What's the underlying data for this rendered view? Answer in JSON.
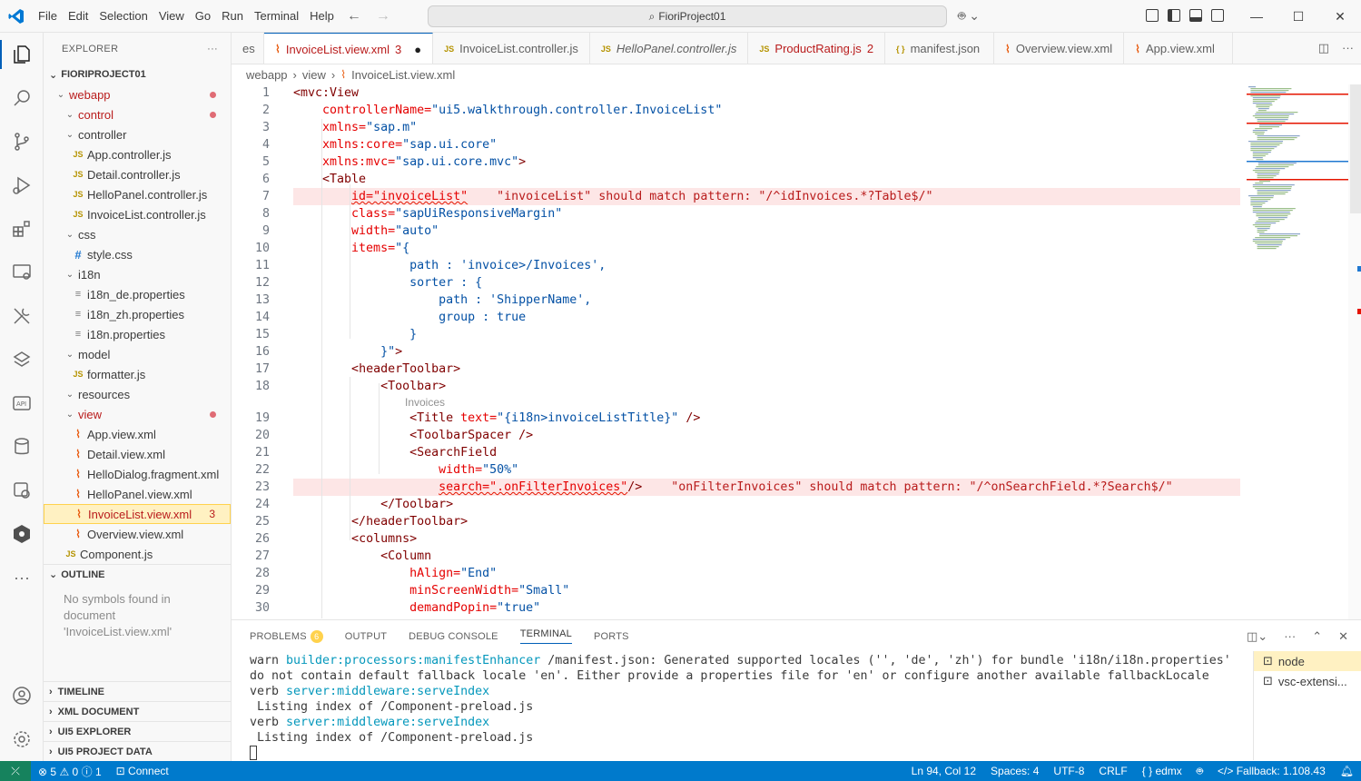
{
  "titlebar": {
    "menu": [
      "File",
      "Edit",
      "Selection",
      "View",
      "Go",
      "Run",
      "Terminal",
      "Help"
    ],
    "search": "FioriProject01"
  },
  "explorer": {
    "header": "EXPLORER",
    "project": "FIORIPROJECT01",
    "tree": [
      {
        "label": "webapp",
        "kind": "folder",
        "depth": 1,
        "error": true,
        "dot": true
      },
      {
        "label": "control",
        "kind": "folder",
        "depth": 2,
        "error": true,
        "dot": true
      },
      {
        "label": "controller",
        "kind": "folder",
        "depth": 2
      },
      {
        "label": "App.controller.js",
        "kind": "js",
        "depth": 3
      },
      {
        "label": "Detail.controller.js",
        "kind": "js",
        "depth": 3
      },
      {
        "label": "HelloPanel.controller.js",
        "kind": "js",
        "depth": 3
      },
      {
        "label": "InvoiceList.controller.js",
        "kind": "js",
        "depth": 3
      },
      {
        "label": "css",
        "kind": "folder",
        "depth": 2
      },
      {
        "label": "style.css",
        "kind": "css",
        "depth": 3
      },
      {
        "label": "i18n",
        "kind": "folder",
        "depth": 2
      },
      {
        "label": "i18n_de.properties",
        "kind": "props",
        "depth": 3
      },
      {
        "label": "i18n_zh.properties",
        "kind": "props",
        "depth": 3
      },
      {
        "label": "i18n.properties",
        "kind": "props",
        "depth": 3
      },
      {
        "label": "model",
        "kind": "folder",
        "depth": 2
      },
      {
        "label": "formatter.js",
        "kind": "js",
        "depth": 3
      },
      {
        "label": "resources",
        "kind": "folder",
        "depth": 2
      },
      {
        "label": "view",
        "kind": "folder",
        "depth": 2,
        "error": true,
        "dot": true
      },
      {
        "label": "App.view.xml",
        "kind": "xml",
        "depth": 3
      },
      {
        "label": "Detail.view.xml",
        "kind": "xml",
        "depth": 3
      },
      {
        "label": "HelloDialog.fragment.xml",
        "kind": "xml",
        "depth": 3
      },
      {
        "label": "HelloPanel.view.xml",
        "kind": "xml",
        "depth": 3
      },
      {
        "label": "InvoiceList.view.xml",
        "kind": "xml",
        "depth": 3,
        "error": true,
        "selected": true,
        "badge": "3"
      },
      {
        "label": "Overview.view.xml",
        "kind": "xml",
        "depth": 3
      },
      {
        "label": "Component.js",
        "kind": "js",
        "depth": 2
      }
    ],
    "outline_title": "OUTLINE",
    "outline_message": "No symbols found in document 'InvoiceList.view.xml'",
    "collapsed_sections": [
      "TIMELINE",
      "XML DOCUMENT",
      "UI5 EXPLORER",
      "UI5 PROJECT DATA"
    ]
  },
  "tabs": [
    {
      "label": "es",
      "icon": "",
      "partial": true
    },
    {
      "label": "InvoiceList.view.xml",
      "icon": "xml",
      "active": true,
      "badge": "3",
      "dirty": true
    },
    {
      "label": "InvoiceList.controller.js",
      "icon": "js"
    },
    {
      "label": "HelloPanel.controller.js",
      "icon": "js",
      "italic": true
    },
    {
      "label": "ProductRating.js",
      "icon": "js",
      "error": true,
      "badge": "2"
    },
    {
      "label": "manifest.json",
      "icon": "json"
    },
    {
      "label": "Overview.view.xml",
      "icon": "xml"
    },
    {
      "label": "App.view.xml",
      "icon": "xml"
    }
  ],
  "breadcrumb": [
    "webapp",
    "view",
    "InvoiceList.view.xml"
  ],
  "editor": {
    "codelens_text": "Invoices",
    "error_annotations": [
      "\"invoiceList\" should match pattern: \"/^idInvoices.*?Table$/\"",
      "\"onFilterInvoices\" should match pattern: \"/^onSearchField.*?Search$/\""
    ],
    "lines": [
      {
        "n": "1",
        "segs": [
          [
            "tag",
            "<mvc:View"
          ]
        ]
      },
      {
        "n": "2",
        "segs": [
          [
            "txt",
            "    controllerName="
          ],
          [
            "str",
            "\"ui5.walkthrough.controller.InvoiceList\""
          ]
        ]
      },
      {
        "n": "3",
        "segs": [
          [
            "txt",
            "    xmlns="
          ],
          [
            "str",
            "\"sap.m\""
          ]
        ]
      },
      {
        "n": "4",
        "segs": [
          [
            "txt",
            "    xmlns:core="
          ],
          [
            "str",
            "\"sap.ui.core\""
          ]
        ]
      },
      {
        "n": "5",
        "segs": [
          [
            "txt",
            "    xmlns:mvc="
          ],
          [
            "str",
            "\"sap.ui.core.mvc\""
          ],
          [
            "tag",
            ">"
          ]
        ]
      },
      {
        "n": "6",
        "segs": [
          [
            "tag",
            "    <Table"
          ]
        ]
      },
      {
        "n": "7",
        "segs": [
          [
            "txt",
            "        "
          ],
          [
            "sq",
            "id=\"invoiceList\""
          ],
          [
            "ann",
            "    \"invoiceList\" should match pattern: \"/^idInvoices.*?Table$/\""
          ]
        ],
        "err": true
      },
      {
        "n": "8",
        "segs": [
          [
            "txt",
            "        class="
          ],
          [
            "str",
            "\"sapUiResponsiveMargin\""
          ]
        ]
      },
      {
        "n": "9",
        "segs": [
          [
            "txt",
            "        width="
          ],
          [
            "str",
            "\"auto\""
          ]
        ]
      },
      {
        "n": "10",
        "segs": [
          [
            "txt",
            "        items="
          ],
          [
            "str",
            "\"{"
          ]
        ]
      },
      {
        "n": "11",
        "segs": [
          [
            "str",
            "                path : 'invoice>/Invoices',"
          ]
        ]
      },
      {
        "n": "12",
        "segs": [
          [
            "str",
            "                sorter : {"
          ]
        ]
      },
      {
        "n": "13",
        "segs": [
          [
            "str",
            "                    path : 'ShipperName',"
          ]
        ]
      },
      {
        "n": "14",
        "segs": [
          [
            "str",
            "                    group : true"
          ]
        ]
      },
      {
        "n": "15",
        "segs": [
          [
            "str",
            "                }"
          ]
        ]
      },
      {
        "n": "16",
        "segs": [
          [
            "str",
            "            }\""
          ],
          [
            "tag",
            ">"
          ]
        ]
      },
      {
        "n": "17",
        "segs": [
          [
            "tag",
            "        <"
          ],
          [
            "tagb",
            "headerToolbar"
          ],
          [
            "tag",
            ">"
          ]
        ]
      },
      {
        "n": "18",
        "segs": [
          [
            "tag",
            "            <"
          ],
          [
            "tagb",
            "Toolbar"
          ],
          [
            "tag",
            ">"
          ]
        ]
      },
      {
        "n": "19",
        "segs": [
          [
            "tag",
            "                <"
          ],
          [
            "tagb",
            "Title"
          ],
          [
            "txt",
            " text="
          ],
          [
            "str",
            "\"{i18n>invoiceListTitle}\""
          ],
          [
            "tag",
            " />"
          ]
        ]
      },
      {
        "n": "20",
        "segs": [
          [
            "tag",
            "                <"
          ],
          [
            "tagb",
            "ToolbarSpacer"
          ],
          [
            "tag",
            " />"
          ]
        ]
      },
      {
        "n": "21",
        "segs": [
          [
            "tag",
            "                <"
          ],
          [
            "tagb",
            "SearchField"
          ]
        ]
      },
      {
        "n": "22",
        "segs": [
          [
            "txt",
            "                    width="
          ],
          [
            "str",
            "\"50%\""
          ]
        ]
      },
      {
        "n": "23",
        "segs": [
          [
            "txt",
            "                    "
          ],
          [
            "sq",
            "search=\".onFilterInvoices\""
          ],
          [
            "tag",
            "/>"
          ],
          [
            "ann",
            "    \"onFilterInvoices\" should match pattern: \"/^onSearchField.*?Search$/\""
          ]
        ],
        "err": true
      },
      {
        "n": "24",
        "segs": [
          [
            "tag",
            "            </"
          ],
          [
            "tagb",
            "Toolbar"
          ],
          [
            "tag",
            ">"
          ]
        ]
      },
      {
        "n": "25",
        "segs": [
          [
            "tag",
            "        </"
          ],
          [
            "tagb",
            "headerToolbar"
          ],
          [
            "tag",
            ">"
          ]
        ]
      },
      {
        "n": "26",
        "segs": [
          [
            "tag",
            "        <"
          ],
          [
            "tagb",
            "columns"
          ],
          [
            "tag",
            ">"
          ]
        ]
      },
      {
        "n": "27",
        "segs": [
          [
            "tag",
            "            <"
          ],
          [
            "tagb",
            "Column"
          ]
        ]
      },
      {
        "n": "28",
        "segs": [
          [
            "txt",
            "                hAlign="
          ],
          [
            "str",
            "\"End\""
          ]
        ]
      },
      {
        "n": "29",
        "segs": [
          [
            "txt",
            "                minScreenWidth="
          ],
          [
            "str",
            "\"Small\""
          ]
        ]
      },
      {
        "n": "30",
        "segs": [
          [
            "txt",
            "                demandPopin="
          ],
          [
            "str",
            "\"true\""
          ]
        ]
      }
    ]
  },
  "panel": {
    "tabs": [
      "PROBLEMS",
      "OUTPUT",
      "DEBUG CONSOLE",
      "TERMINAL",
      "PORTS"
    ],
    "problems_count": "6",
    "active_tab": "TERMINAL",
    "terminal_lines": [
      {
        "kind": "warn",
        "prefix": "warn ",
        "cyan": "builder:processors:manifestEnhancer",
        "text": " /manifest.json: Generated supported locales ('', 'de', 'zh') for bundle 'i18n/i18n.properties' do not contain default fallback locale 'en'. Either provide a properties file for 'en' or configure another available fallbackLocale"
      },
      {
        "kind": "verb",
        "prefix": "verb ",
        "cyan": "server:middleware:serveIndex",
        "text": ""
      },
      {
        "kind": "plain",
        "prefix": "",
        "cyan": "",
        "text": " Listing index of /Component-preload.js"
      },
      {
        "kind": "verb",
        "prefix": "verb ",
        "cyan": "server:middleware:serveIndex",
        "text": ""
      },
      {
        "kind": "plain",
        "prefix": "",
        "cyan": "",
        "text": " Listing index of /Component-preload.js"
      }
    ],
    "terminals": [
      "node",
      "vsc-extensi..."
    ]
  },
  "statusbar": {
    "errors": "5",
    "warnings": "0",
    "info": "1",
    "connect": "Connect",
    "position": "Ln 94, Col 12",
    "spaces": "Spaces: 4",
    "encoding": "UTF-8",
    "eol": "CRLF",
    "language": "edmx",
    "fallback": "Fallback: 1.108.43"
  },
  "colors": {
    "accent": "#005fb8",
    "statusbar": "#007acc",
    "error": "#b91c1c",
    "selected_bg": "#fff1c2"
  }
}
